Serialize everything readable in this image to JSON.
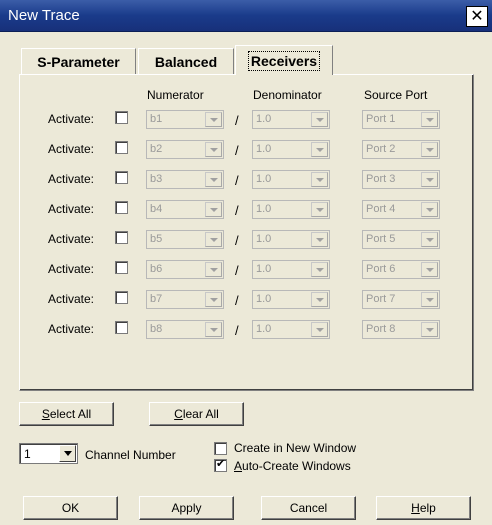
{
  "window": {
    "title": "New Trace",
    "close_glyph": "✕"
  },
  "tabs": [
    {
      "label": "S-Parameter",
      "active": false
    },
    {
      "label": "Balanced",
      "active": false
    },
    {
      "label": "Receivers",
      "active": true
    }
  ],
  "columns": {
    "numerator": "Numerator",
    "denominator": "Denominator",
    "source_port": "Source Port"
  },
  "rows": [
    {
      "label": "Activate:",
      "checked": false,
      "numerator": "b1",
      "denominator": "1.0",
      "source": "Port 1"
    },
    {
      "label": "Activate:",
      "checked": false,
      "numerator": "b2",
      "denominator": "1.0",
      "source": "Port 2"
    },
    {
      "label": "Activate:",
      "checked": false,
      "numerator": "b3",
      "denominator": "1.0",
      "source": "Port 3"
    },
    {
      "label": "Activate:",
      "checked": false,
      "numerator": "b4",
      "denominator": "1.0",
      "source": "Port 4"
    },
    {
      "label": "Activate:",
      "checked": false,
      "numerator": "b5",
      "denominator": "1.0",
      "source": "Port 5"
    },
    {
      "label": "Activate:",
      "checked": false,
      "numerator": "b6",
      "denominator": "1.0",
      "source": "Port 6"
    },
    {
      "label": "Activate:",
      "checked": false,
      "numerator": "b7",
      "denominator": "1.0",
      "source": "Port 7"
    },
    {
      "label": "Activate:",
      "checked": false,
      "numerator": "b8",
      "denominator": "1.0",
      "source": "Port 8"
    }
  ],
  "divider": "/",
  "select_all": {
    "mnemonic": "S",
    "rest": "elect All"
  },
  "clear_all": {
    "mnemonic": "C",
    "rest": "lear All"
  },
  "channel": {
    "value": "1",
    "label": "Channel Number"
  },
  "options": {
    "new_window": {
      "label": "Create in New Window",
      "checked": false
    },
    "auto_create": {
      "mnemonic": "A",
      "rest": "uto-Create Windows",
      "checked": true
    }
  },
  "buttons": {
    "ok": "OK",
    "apply": "Apply",
    "cancel": "Cancel",
    "help": {
      "mnemonic": "H",
      "rest": "elp"
    }
  },
  "colors": {
    "title_bar": "#1a3b8a",
    "dialog_bg": "#ece9d8",
    "disabled_text": "#9a9a9a"
  }
}
